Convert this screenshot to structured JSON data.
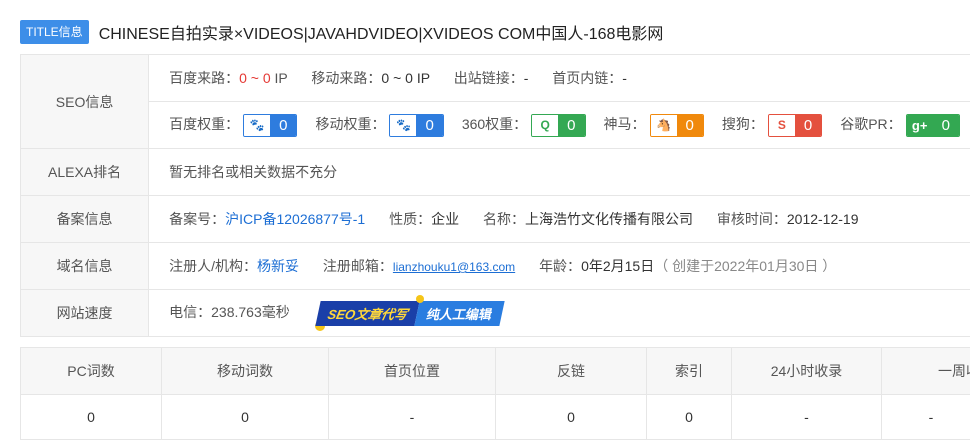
{
  "title": {
    "badge": "TITLE信息",
    "text": "CHINESE自拍实录×VIDEOS|JAVAHDVIDEO|XVIDEOS COM中国人-168电影网"
  },
  "seo": {
    "label": "SEO信息",
    "baidu_source_label": "百度来路：",
    "baidu_source_value": "0 ~ 0",
    "baidu_source_unit": "IP",
    "mobile_source_label": "移动来路：",
    "mobile_source_value": "0 ~ 0 IP",
    "outlinks_label": "出站链接：",
    "outlinks_value": "-",
    "inlinks_label": "首页内链：",
    "inlinks_value": "-",
    "weights": [
      {
        "label": "百度权重：",
        "icon": "baidu-paw",
        "glyph": "🐾",
        "value": "0"
      },
      {
        "label": "移动权重：",
        "icon": "baidu-paw",
        "glyph": "🐾",
        "value": "0"
      },
      {
        "label": "360权重：",
        "icon": "360-logo",
        "glyph": "Q",
        "value": "0"
      },
      {
        "label": "神马：",
        "icon": "shenma-logo",
        "glyph": "🐴",
        "value": "0"
      },
      {
        "label": "搜狗：",
        "icon": "sogou-logo",
        "glyph": "S",
        "value": "0"
      },
      {
        "label": "谷歌PR：",
        "icon": "google-plus",
        "glyph": "g+",
        "value": "0"
      }
    ]
  },
  "alexa": {
    "label": "ALEXA排名",
    "text": "暂无排名或相关数据不充分"
  },
  "icp": {
    "label": "备案信息",
    "no_label": "备案号：",
    "no_value": "沪ICP备12026877号-1",
    "nature_label": "性质：",
    "nature_value": "企业",
    "name_label": "名称：",
    "name_value": "上海浩竹文化传播有限公司",
    "audit_label": "审核时间：",
    "audit_value": "2012-12-19"
  },
  "domain": {
    "label": "域名信息",
    "registrant_label": "注册人/机构：",
    "registrant_value": "杨新妥",
    "email_label": "注册邮箱：",
    "email_value": "lianzhouku1@163.com",
    "age_label": "年龄：",
    "age_value": "0年2月15日",
    "created_note": "（ 创建于2022年01月30日 ）"
  },
  "speed": {
    "label": "网站速度",
    "value": "电信：238.763毫秒",
    "promo_left": "SEO文章代写",
    "promo_right": "纯人工编辑"
  },
  "stats": {
    "headers": [
      "PC词数",
      "移动词数",
      "首页位置",
      "反链",
      "索引",
      "24小时收录",
      "一周收"
    ],
    "values": [
      "0",
      "0",
      "-",
      "0",
      "0",
      "-",
      "-"
    ]
  }
}
